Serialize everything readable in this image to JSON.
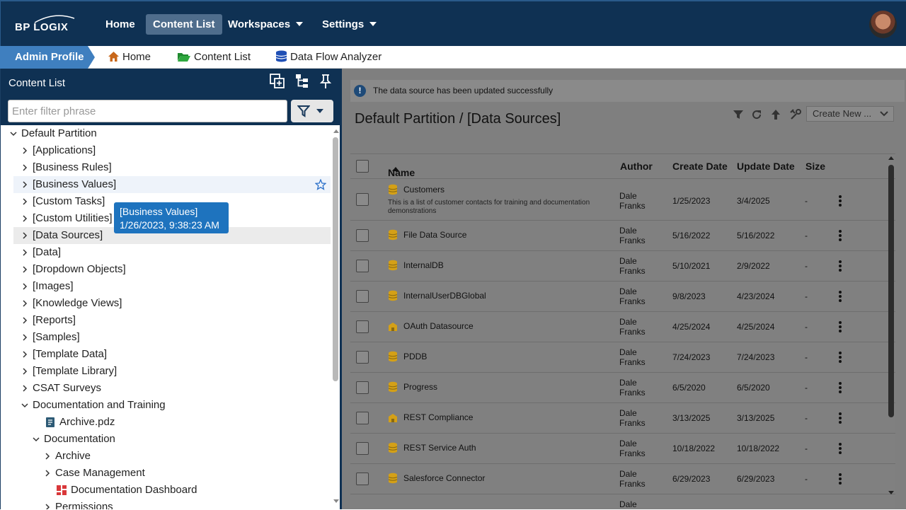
{
  "topbar": {
    "logo_text": "BP LOGIX",
    "nav": [
      {
        "label": "Home"
      },
      {
        "label": "Content List",
        "active": true
      },
      {
        "label": "Workspaces"
      },
      {
        "label": "Settings"
      }
    ]
  },
  "breadcrumb": {
    "profile": "Admin Profile",
    "items": [
      "Home",
      "Content List",
      "Data Flow Analyzer"
    ]
  },
  "left": {
    "title": "Content List",
    "filter_placeholder": "Enter filter phrase",
    "tree": [
      {
        "label": "Default Partition"
      },
      {
        "label": "[Applications]"
      },
      {
        "label": "[Business Rules]"
      },
      {
        "label": "[Business Values]"
      },
      {
        "label": "[Custom Tasks]"
      },
      {
        "label": "[Custom Utilities]"
      },
      {
        "label": "[Data Sources]"
      },
      {
        "label": "[Data]"
      },
      {
        "label": "[Dropdown Objects]"
      },
      {
        "label": "[Images]"
      },
      {
        "label": "[Knowledge Views]"
      },
      {
        "label": "[Reports]"
      },
      {
        "label": "[Samples]"
      },
      {
        "label": "[Template Data]"
      },
      {
        "label": "[Template Library]"
      },
      {
        "label": "CSAT Surveys"
      },
      {
        "label": "Documentation and Training"
      },
      {
        "label": "Archive.pdz"
      },
      {
        "label": "Documentation"
      },
      {
        "label": "Archive"
      },
      {
        "label": "Case Management"
      },
      {
        "label": "Documentation Dashboard"
      },
      {
        "label": "Permissions"
      }
    ],
    "tooltip": {
      "line1": "[Business Values]",
      "line2": "1/26/2023, 9:38:23 AM"
    }
  },
  "right": {
    "notice": "The data source has been updated successfully",
    "title": "Default Partition / [Data Sources]",
    "create_new": "Create New ...",
    "columns": {
      "name": "Name",
      "author": "Author",
      "create": "Create Date",
      "update": "Update Date",
      "size": "Size"
    },
    "rows": [
      {
        "name": "Customers",
        "desc": "This is a list of customer contacts for training and documentation demonstrations",
        "author1": "Dale",
        "author2": "Franks",
        "create": "1/25/2023",
        "update": "3/4/2025",
        "size": "-",
        "icon": "database-icon"
      },
      {
        "name": "File Data Source",
        "desc": "",
        "author1": "Dale",
        "author2": "Franks",
        "create": "5/16/2022",
        "update": "5/16/2022",
        "size": "-",
        "icon": "database-icon"
      },
      {
        "name": "InternalDB",
        "desc": "",
        "author1": "Dale",
        "author2": "Franks",
        "create": "5/10/2021",
        "update": "2/9/2022",
        "size": "-",
        "icon": "database-icon"
      },
      {
        "name": "InternalUserDBGlobal",
        "desc": "",
        "author1": "Dale",
        "author2": "Franks",
        "create": "9/8/2023",
        "update": "4/23/2024",
        "size": "-",
        "icon": "database-icon"
      },
      {
        "name": "OAuth Datasource",
        "desc": "",
        "author1": "Dale",
        "author2": "Franks",
        "create": "4/25/2024",
        "update": "4/25/2024",
        "size": "-",
        "icon": "building-icon"
      },
      {
        "name": "PDDB",
        "desc": "",
        "author1": "Dale",
        "author2": "Franks",
        "create": "7/24/2023",
        "update": "7/24/2023",
        "size": "-",
        "icon": "database-icon"
      },
      {
        "name": "Progress",
        "desc": "",
        "author1": "Dale",
        "author2": "Franks",
        "create": "6/5/2020",
        "update": "6/5/2020",
        "size": "-",
        "icon": "database-icon"
      },
      {
        "name": "REST Compliance",
        "desc": "",
        "author1": "Dale",
        "author2": "Franks",
        "create": "3/13/2025",
        "update": "3/13/2025",
        "size": "-",
        "icon": "building-icon"
      },
      {
        "name": "REST Service Auth",
        "desc": "",
        "author1": "Dale",
        "author2": "Franks",
        "create": "10/18/2022",
        "update": "10/18/2022",
        "size": "-",
        "icon": "database-icon"
      },
      {
        "name": "Salesforce Connector",
        "desc": "",
        "author1": "Dale",
        "author2": "Franks",
        "create": "6/29/2023",
        "update": "6/29/2023",
        "size": "-",
        "icon": "database-icon"
      },
      {
        "name": "",
        "desc": "",
        "author1": "Dale",
        "author2": "",
        "create": "",
        "update": "",
        "size": "",
        "icon": ""
      }
    ]
  }
}
